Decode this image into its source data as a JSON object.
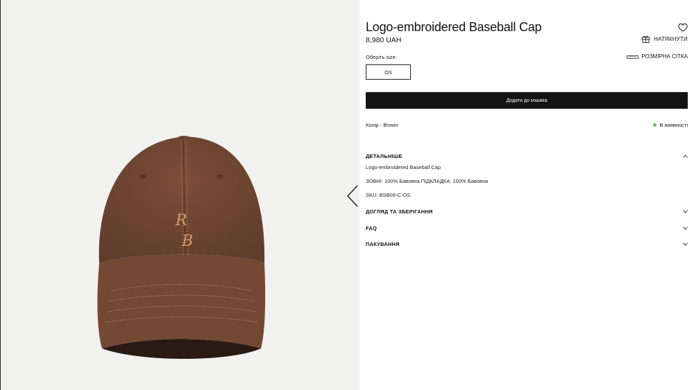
{
  "product": {
    "title": "Logo-embroidered Baseball Cap",
    "price": "8,980 UAH"
  },
  "actions": {
    "hint_label": "НАТЯКНУТИ",
    "size_chart_label": "РОЗМІРНА СІТКА",
    "add_to_cart_label": "Додати до кошика"
  },
  "size": {
    "label": "Оберіть size:",
    "options": [
      "OS"
    ]
  },
  "color": {
    "text": "Колір - Brown"
  },
  "stock": {
    "text": "В наявності",
    "dot_color": "#65c466"
  },
  "accordion": {
    "details": {
      "title": "ДЕТАЛЬНІШЕ",
      "lines": [
        "Logo-embroidered Baseball Cap",
        "ЗОВНІ: 100% Бавовна ПІДКЛАДКА: 100% Бавовна",
        "SKU: BSB09-C-OS"
      ]
    },
    "care": {
      "title": "ДОГЛЯД ТА ЗБЕРІГАННЯ"
    },
    "faq": {
      "title": "FAQ"
    },
    "packaging": {
      "title": "ПАКУВАННЯ"
    }
  },
  "icons": {
    "wishlist": "heart-icon",
    "hint": "gift-icon",
    "size_chart": "ruler-icon",
    "gallery_prev": "chevron-left-icon",
    "expand": "chevron-down-icon",
    "collapse": "chevron-up-icon"
  },
  "colors": {
    "button_bg": "#141414",
    "gallery_bg": "#f1f1ef",
    "cap": "#7d4f38"
  },
  "monogram": "R B"
}
